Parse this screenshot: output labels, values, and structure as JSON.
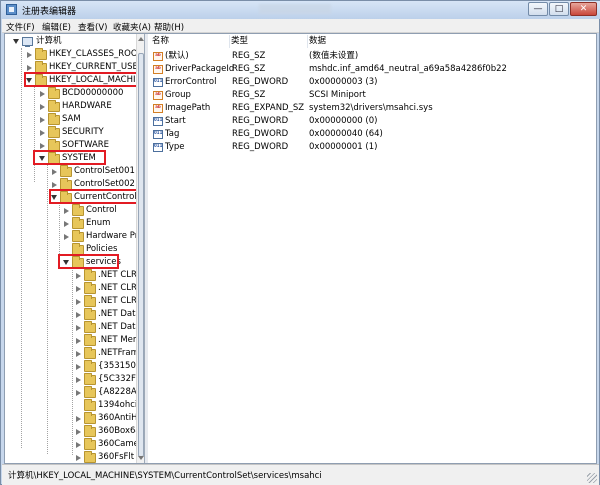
{
  "window": {
    "title": "注册表编辑器",
    "controls": {
      "minimize": "—",
      "maximize": "□",
      "close": "✕"
    }
  },
  "menus": [
    "文件(F)",
    "编辑(E)",
    "查看(V)",
    "收藏夹(A)",
    "帮助(H)"
  ],
  "tree": [
    {
      "label": "计算机",
      "icon": "computer-icon",
      "expander": "open"
    },
    {
      "label": "HKEY_CLASSES_ROOT",
      "icon": "folder-icon",
      "expander": "closed"
    },
    {
      "label": "HKEY_CURRENT_USER",
      "icon": "folder-icon",
      "expander": "closed"
    },
    {
      "label": "HKEY_LOCAL_MACHINE",
      "icon": "folder-icon",
      "expander": "open",
      "highlighted": true
    },
    {
      "label": "BCD00000000",
      "icon": "folder-icon",
      "expander": "closed"
    },
    {
      "label": "HARDWARE",
      "icon": "folder-icon",
      "expander": "closed"
    },
    {
      "label": "SAM",
      "icon": "folder-icon",
      "expander": "closed"
    },
    {
      "label": "SECURITY",
      "icon": "folder-icon",
      "expander": "closed"
    },
    {
      "label": "SOFTWARE",
      "icon": "folder-icon",
      "expander": "closed"
    },
    {
      "label": "SYSTEM",
      "icon": "folder-icon",
      "expander": "open",
      "highlighted": true
    },
    {
      "label": "ControlSet001",
      "icon": "folder-icon",
      "expander": "closed"
    },
    {
      "label": "ControlSet002",
      "icon": "folder-icon",
      "expander": "closed"
    },
    {
      "label": "CurrentControlSet",
      "icon": "folder-icon",
      "expander": "open",
      "highlighted": true
    },
    {
      "label": "Control",
      "icon": "folder-icon",
      "expander": "closed"
    },
    {
      "label": "Enum",
      "icon": "folder-icon",
      "expander": "closed"
    },
    {
      "label": "Hardware Profiles",
      "icon": "folder-icon",
      "expander": "closed"
    },
    {
      "label": "Policies",
      "icon": "folder-icon",
      "expander": "none"
    },
    {
      "label": "services",
      "icon": "folder-icon",
      "expander": "open",
      "highlighted": true
    },
    {
      "label": ".NET CLR",
      "icon": "folder-icon",
      "expander": "closed"
    },
    {
      "label": ".NET CLR",
      "icon": "folder-icon",
      "expander": "closed"
    },
    {
      "label": ".NET CLR",
      "icon": "folder-icon",
      "expander": "closed"
    },
    {
      "label": ".NET Data",
      "icon": "folder-icon",
      "expander": "closed"
    },
    {
      "label": ".NET Data",
      "icon": "folder-icon",
      "expander": "closed"
    },
    {
      "label": ".NET Mem",
      "icon": "folder-icon",
      "expander": "closed"
    },
    {
      "label": ".NETFram",
      "icon": "folder-icon",
      "expander": "closed"
    },
    {
      "label": "{35315048",
      "icon": "folder-icon",
      "expander": "closed"
    },
    {
      "label": "{5C332F42",
      "icon": "folder-icon",
      "expander": "closed"
    },
    {
      "label": "{A8228A3",
      "icon": "folder-icon",
      "expander": "closed"
    },
    {
      "label": "1394ohci",
      "icon": "folder-icon",
      "expander": "none"
    },
    {
      "label": "360AntiHa",
      "icon": "folder-icon",
      "expander": "closed"
    },
    {
      "label": "360Box64",
      "icon": "folder-icon",
      "expander": "closed"
    },
    {
      "label": "360Camer",
      "icon": "folder-icon",
      "expander": "closed"
    },
    {
      "label": "360FsFlt",
      "icon": "folder-icon",
      "expander": "closed"
    }
  ],
  "list": {
    "columns": [
      "名称",
      "类型",
      "数据"
    ],
    "rows": [
      {
        "icon": "string-value-icon",
        "name": "(默认)",
        "type": "REG_SZ",
        "data": "(数值未设置)"
      },
      {
        "icon": "string-value-icon",
        "name": "DriverPackageId",
        "type": "REG_SZ",
        "data": "mshdc.inf_amd64_neutral_a69a58a4286f0b22"
      },
      {
        "icon": "binary-value-icon",
        "name": "ErrorControl",
        "type": "REG_DWORD",
        "data": "0x00000003 (3)"
      },
      {
        "icon": "string-value-icon",
        "name": "Group",
        "type": "REG_SZ",
        "data": "SCSI Miniport"
      },
      {
        "icon": "string-value-icon",
        "name": "ImagePath",
        "type": "REG_EXPAND_SZ",
        "data": "system32\\drivers\\msahci.sys"
      },
      {
        "icon": "binary-value-icon",
        "name": "Start",
        "type": "REG_DWORD",
        "data": "0x00000000 (0)"
      },
      {
        "icon": "binary-value-icon",
        "name": "Tag",
        "type": "REG_DWORD",
        "data": "0x00000040 (64)"
      },
      {
        "icon": "binary-value-icon",
        "name": "Type",
        "type": "REG_DWORD",
        "data": "0x00000001 (1)"
      }
    ]
  },
  "status": {
    "path": "计算机\\HKEY_LOCAL_MACHINE\\SYSTEM\\CurrentControlSet\\services\\msahci"
  },
  "colors": {
    "highlight": "#e21b23",
    "folder": "#e7c65a",
    "window_frame": "#c7d7ec"
  }
}
